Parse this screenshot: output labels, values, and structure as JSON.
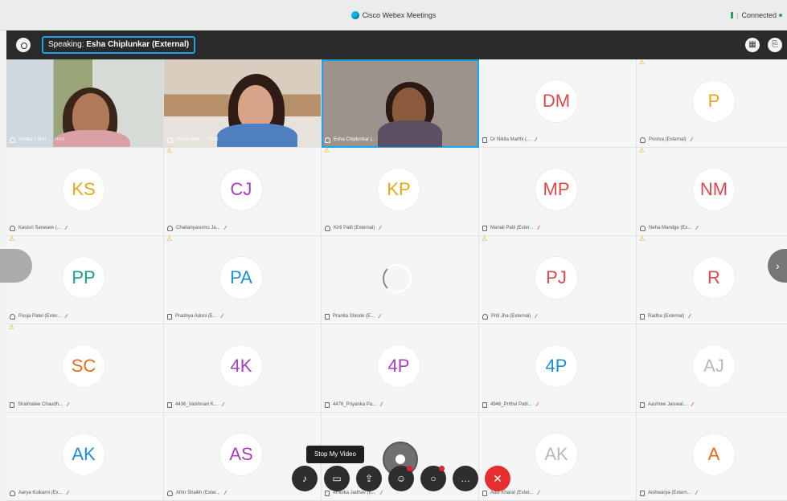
{
  "window": {
    "title": "Cisco Webex Meetings",
    "status": "Connected"
  },
  "topbar": {
    "speaking_label": "Speaking:",
    "speaking_name": "Esha Chiplunkar (External)"
  },
  "controls": {
    "tooltip": "Stop My Video"
  },
  "tiles": [
    {
      "type": "video",
      "name": "Sunita J (Ext...",
      "suffix": "Host",
      "icon": "head",
      "warn": false
    },
    {
      "type": "video",
      "name": "Khanti Abh...",
      "suffix": "Host",
      "icon": "head",
      "warn": false
    },
    {
      "type": "video",
      "name": "Esha Chiplunkar (...",
      "suffix": "",
      "icon": "head",
      "warn": false,
      "active": true
    },
    {
      "initials": "DM",
      "color": "#e04848",
      "name": "Dr Nikita Marthi (...",
      "icon": "dev",
      "mute": true,
      "warn": false
    },
    {
      "initials": "P",
      "color": "#e6a817",
      "name": "Poorva (External)",
      "icon": "head",
      "mute": true,
      "warn": true
    },
    {
      "initials": "KS",
      "color": "#e6a817",
      "name": "Kasturi Sanware (...",
      "icon": "head",
      "mute": true,
      "warn": false
    },
    {
      "initials": "CJ",
      "color": "#a83dbd",
      "name": "Chaitanyasumu Ja...",
      "icon": "head",
      "mute": true,
      "warn": true
    },
    {
      "initials": "KP",
      "color": "#e6a817",
      "name": "Kirti Patil (External)",
      "icon": "head",
      "mute": true,
      "warn": true
    },
    {
      "initials": "MP",
      "color": "#e04848",
      "name": "Manali Patil (Exter...",
      "icon": "dev",
      "mute": true,
      "warn": false
    },
    {
      "initials": "NM",
      "color": "#e04848",
      "name": "Neha Mandge (Ex...",
      "icon": "head",
      "mute": true,
      "warn": true
    },
    {
      "initials": "PP",
      "color": "#16a085",
      "name": "Pooja Patel (Exter...",
      "icon": "head",
      "mute": true,
      "warn": true
    },
    {
      "initials": "PA",
      "color": "#1a8fd6",
      "name": "Pradnya Adoni (E...",
      "icon": "dev",
      "mute": true,
      "warn": true
    },
    {
      "type": "loading",
      "name": "Pranita Shinde (E...",
      "icon": "dev",
      "mute": true,
      "warn": false
    },
    {
      "initials": "PJ",
      "color": "#e04848",
      "name": "Priti Jha (External)",
      "icon": "head",
      "mute": true,
      "warn": true
    },
    {
      "initials": "R",
      "color": "#e04848",
      "name": "Radha (External)",
      "icon": "dev",
      "mute": true,
      "warn": true
    },
    {
      "initials": "SC",
      "color": "#e86a1a",
      "name": "Shalmalee Chaudh...",
      "icon": "dev",
      "mute": true,
      "warn": true
    },
    {
      "initials": "4K",
      "color": "#a83dbd",
      "name": "4436_Vaishnavi K...",
      "icon": "dev",
      "mute": true,
      "warn": false
    },
    {
      "initials": "4P",
      "color": "#a83dbd",
      "name": "4476_Priyanka Pa...",
      "icon": "dev",
      "mute": true,
      "warn": false
    },
    {
      "initials": "4P",
      "color": "#1a8fd6",
      "name": "4946_Prithvi Patil...",
      "icon": "dev",
      "mute": true,
      "warn": false
    },
    {
      "initials": "AJ",
      "color": "#b9b9b9",
      "name": "Aashree Jaiswal...",
      "icon": "dev",
      "mute": true,
      "warn": false
    },
    {
      "initials": "AK",
      "color": "#1a8fd6",
      "name": "Aarya Kulkarni (Ex...",
      "icon": "head",
      "mute": true,
      "warn": false
    },
    {
      "initials": "AS",
      "color": "#a83dbd",
      "name": "Afrin Shaikh (Exter...",
      "icon": "head",
      "mute": true,
      "warn": false
    },
    {
      "type": "blank",
      "name": "Ambika Jadhav (E...",
      "icon": "dev",
      "mute": true,
      "warn": false
    },
    {
      "initials": "AK",
      "color": "#b9b9b9",
      "name": "Aditi Kharat (Exter...",
      "icon": "dev",
      "mute": true,
      "warn": false
    },
    {
      "initials": "A",
      "color": "#e86a1a",
      "name": "Aishwarya (Extern...",
      "icon": "dev",
      "mute": true,
      "warn": false
    }
  ]
}
